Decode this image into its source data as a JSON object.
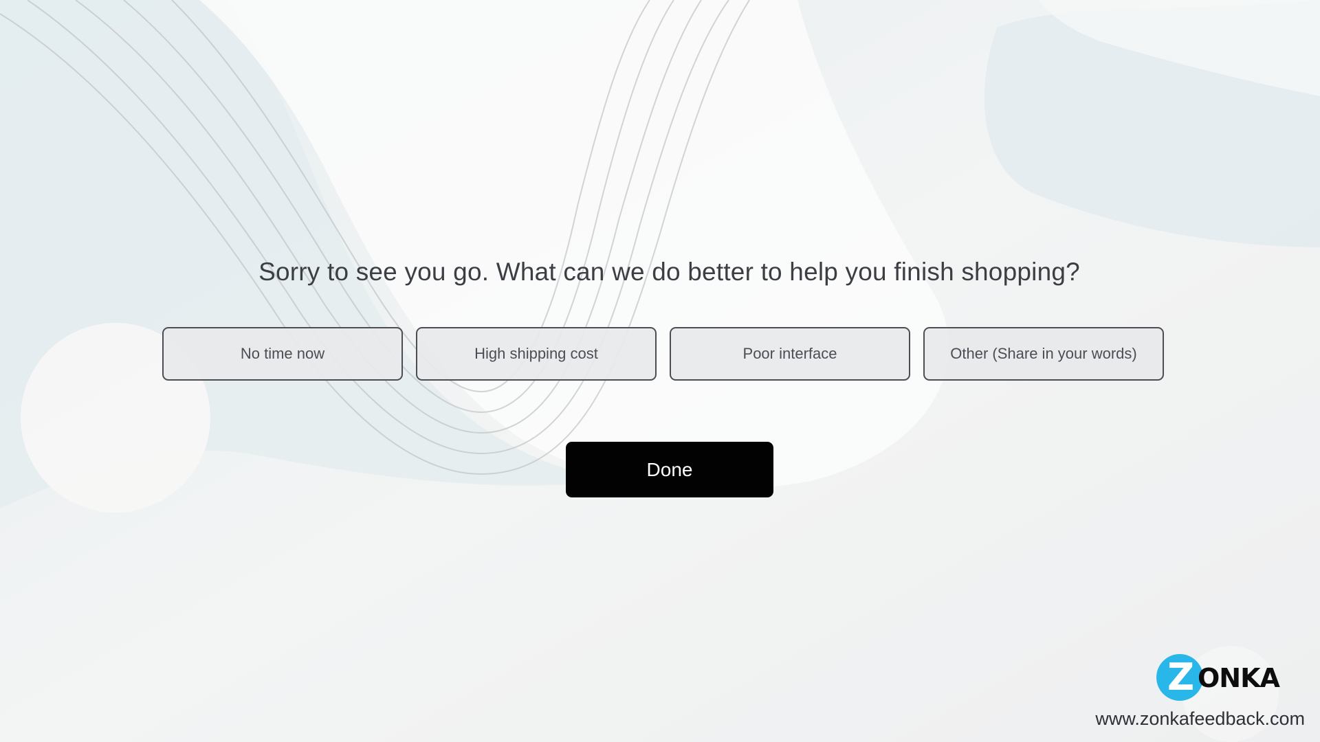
{
  "survey": {
    "question": "Sorry to see you go. What can we do better to help you finish shopping?",
    "options": [
      {
        "label": "No time now"
      },
      {
        "label": "High shipping cost"
      },
      {
        "label": "Poor interface"
      },
      {
        "label": "Other (Share in your words)"
      }
    ],
    "done_label": "Done"
  },
  "branding": {
    "logo_initial": "Z",
    "logo_rest": "ONKA",
    "website": "www.zonkafeedback.com",
    "logo_color": "#29b6e8"
  },
  "colors": {
    "done_button_bg": "#020202",
    "option_border": "#4a4d52",
    "background": "#f2f3f4"
  }
}
